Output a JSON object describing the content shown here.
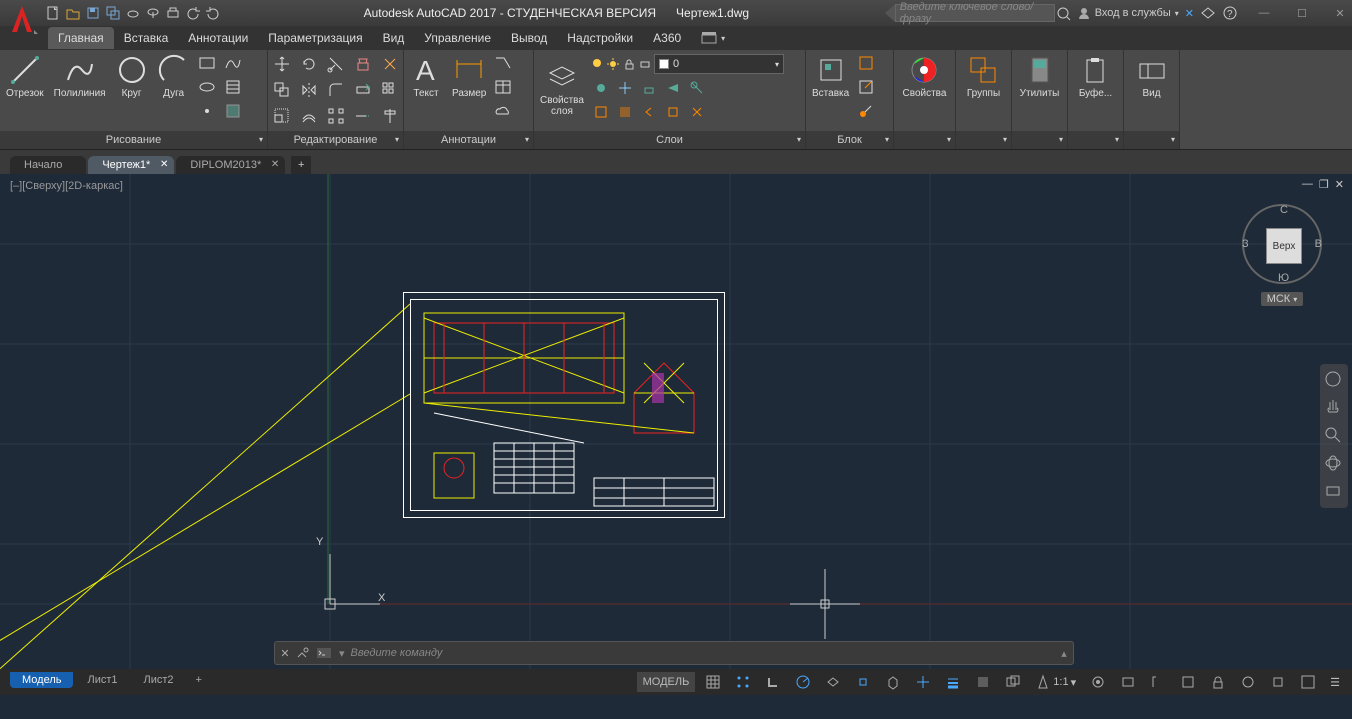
{
  "app": {
    "title": "Autodesk AutoCAD 2017 - СТУДЕНЧЕСКАЯ ВЕРСИЯ",
    "document": "Чертеж1.dwg",
    "search_placeholder": "Введите ключевое слово/фразу",
    "signin": "Вход в службы"
  },
  "menus": [
    "Главная",
    "Вставка",
    "Аннотации",
    "Параметризация",
    "Вид",
    "Управление",
    "Вывод",
    "Надстройки",
    "A360"
  ],
  "panels": {
    "draw": {
      "title": "Рисование",
      "items": [
        "Отрезок",
        "Полилиния",
        "Круг",
        "Дуга"
      ]
    },
    "modify": {
      "title": "Редактирование"
    },
    "annotation": {
      "title": "Аннотации",
      "text": "Текст",
      "dim": "Размер"
    },
    "layers": {
      "title": "Слои",
      "props": "Свойства слоя",
      "current": "0"
    },
    "block": {
      "title": "Блок",
      "insert": "Вставка"
    },
    "properties": {
      "title": "",
      "label": "Свойства"
    },
    "groups": {
      "label": "Группы"
    },
    "utilities": {
      "label": "Утилиты"
    },
    "clipboard": {
      "label": "Буфе..."
    },
    "view": {
      "label": "Вид"
    }
  },
  "filetabs": [
    {
      "label": "Начало",
      "active": false,
      "close": false
    },
    {
      "label": "Чертеж1*",
      "active": true,
      "close": true
    },
    {
      "label": "DIPLOM2013*",
      "active": false,
      "close": true
    }
  ],
  "viewport": {
    "label": "[–][Сверху][2D-каркас]"
  },
  "viewcube": {
    "top": "Верх",
    "n": "С",
    "s": "Ю",
    "w": "З",
    "e": "В",
    "wcs": "МСК"
  },
  "cmdline": {
    "placeholder": "Введите команду"
  },
  "layouttabs": [
    {
      "label": "Модель",
      "active": true
    },
    {
      "label": "Лист1",
      "active": false
    },
    {
      "label": "Лист2",
      "active": false
    }
  ],
  "status": {
    "model": "МОДЕЛЬ",
    "scale": "1:1"
  },
  "ucs": {
    "x": "X",
    "y": "Y"
  }
}
